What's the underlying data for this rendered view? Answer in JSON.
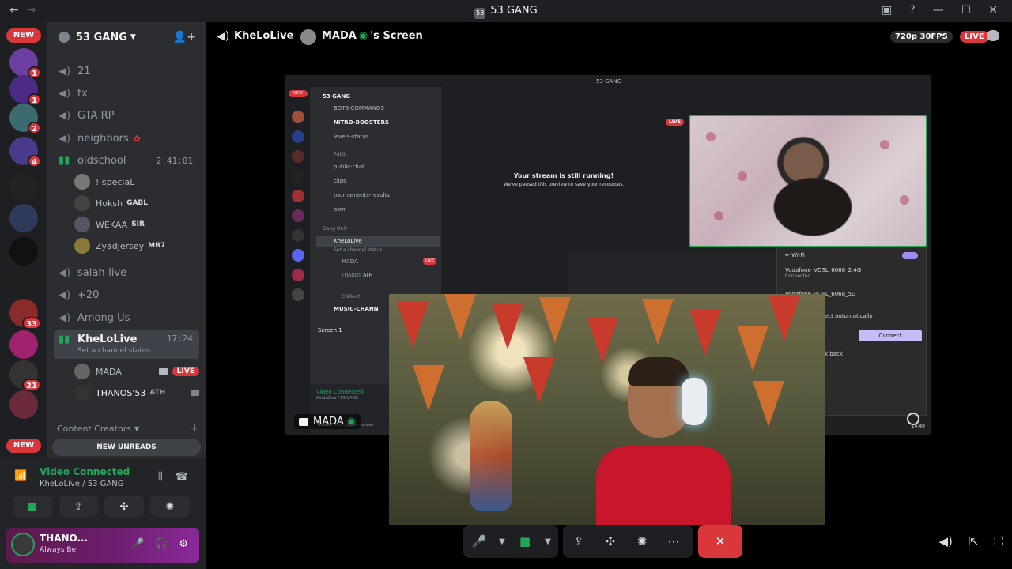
{
  "titlebar": {
    "title": "53 GANG",
    "app_icon_text": "53",
    "back": "←",
    "forward": "→",
    "inbox_icon": "inbox-icon",
    "help": "?",
    "minimize": "—",
    "maximize": "☐",
    "close": "✕"
  },
  "servers": {
    "new_top": "NEW",
    "new_bottom": "NEW",
    "items": [
      {
        "badge": "1",
        "color": "#6b3fa0"
      },
      {
        "badge": "1",
        "color": "#4b2a86"
      },
      {
        "badge": "2",
        "color": "#3b6a6f"
      },
      {
        "badge": "4",
        "color": "#4a3a8a"
      },
      {
        "badge": "",
        "color": "#222222"
      },
      {
        "badge": "",
        "color": "#2e3a5a"
      },
      {
        "badge": "",
        "color": "#111111"
      },
      {
        "badge": "",
        "color": "#1f1f1f"
      },
      {
        "badge": "33",
        "color": "#8a2a2a"
      },
      {
        "badge": "",
        "color": "#a0226e"
      },
      {
        "badge": "21",
        "color": "#333333"
      },
      {
        "badge": "",
        "color": "#6a2a3a"
      }
    ]
  },
  "guild": {
    "name": "53 GANG",
    "channels": [
      {
        "name": "21"
      },
      {
        "name": "tx"
      },
      {
        "name": "GTA RP"
      },
      {
        "name": "neighbors"
      },
      {
        "name": "oldschool",
        "time": "2:41:01"
      },
      {
        "name": "salah-live"
      },
      {
        "name": "+20"
      },
      {
        "name": "Among Us"
      },
      {
        "name": "KheLoLive",
        "time": "17:24",
        "status": "Set a channel status"
      }
    ],
    "oldschool_members": [
      {
        "name": "! speciaL",
        "tag": ""
      },
      {
        "name": "Hoksh",
        "tag": "GABL"
      },
      {
        "name": "WEKAA",
        "tag": "SIR"
      },
      {
        "name": "Zyadjersey",
        "tag": "MB7"
      }
    ],
    "khelolive_members": [
      {
        "name": "MADA",
        "live": "LIVE"
      },
      {
        "name": "THANOS'53",
        "tag": "ATH"
      }
    ],
    "category": "Content Creators",
    "new_unreads": "NEW UNREADS"
  },
  "panel": {
    "video_connected": "Video Connected",
    "location": "KheLoLive / 53 GANG",
    "user_name": "THANO...",
    "user_status": "Always Be"
  },
  "stage": {
    "channel_name": "KheLoLive",
    "screen_owner": "MADA",
    "screen_suffix": "'s Screen",
    "quality": "720p 30FPS",
    "live": "LIVE",
    "streamer_tag": "MADA"
  },
  "shared": {
    "title": "53 GANG",
    "guild": "53 GANG",
    "new": "NEW",
    "rows": [
      "BOTS-COMMANDS",
      "NITRO-BOOSTERS",
      "levels-status",
      "public-chat",
      "clips",
      "tournaments-results",
      "osm"
    ],
    "public": "Public",
    "gang_only": "Gang Only",
    "khelolive": "KheLoLive",
    "set_status": "Set a channel status",
    "mada": "MADA",
    "live": "LIVE",
    "thanos": "THANOS",
    "ath": "ATH",
    "chillout": "Chillout",
    "music": "MUSIC-CHANN",
    "screen1": "Screen 1",
    "vc": "Video Connected",
    "vc_sub": "KheLoLive / 53 GANG",
    "mada_status": "Sharing their screen",
    "live_badge": "LIVE",
    "msg1": "Your stream is still running!",
    "msg2": "We've paused this preview to save your resources.",
    "wifi": "Wi-Fi",
    "net1": "Vodafone_VDSL_6068_2.4G",
    "net1_status": "Connected",
    "net2": "Vodafone_VDSL_6068_5G",
    "auto": "ect automatically",
    "connect": "Connect",
    "back": "k back",
    "time": "14:49"
  }
}
